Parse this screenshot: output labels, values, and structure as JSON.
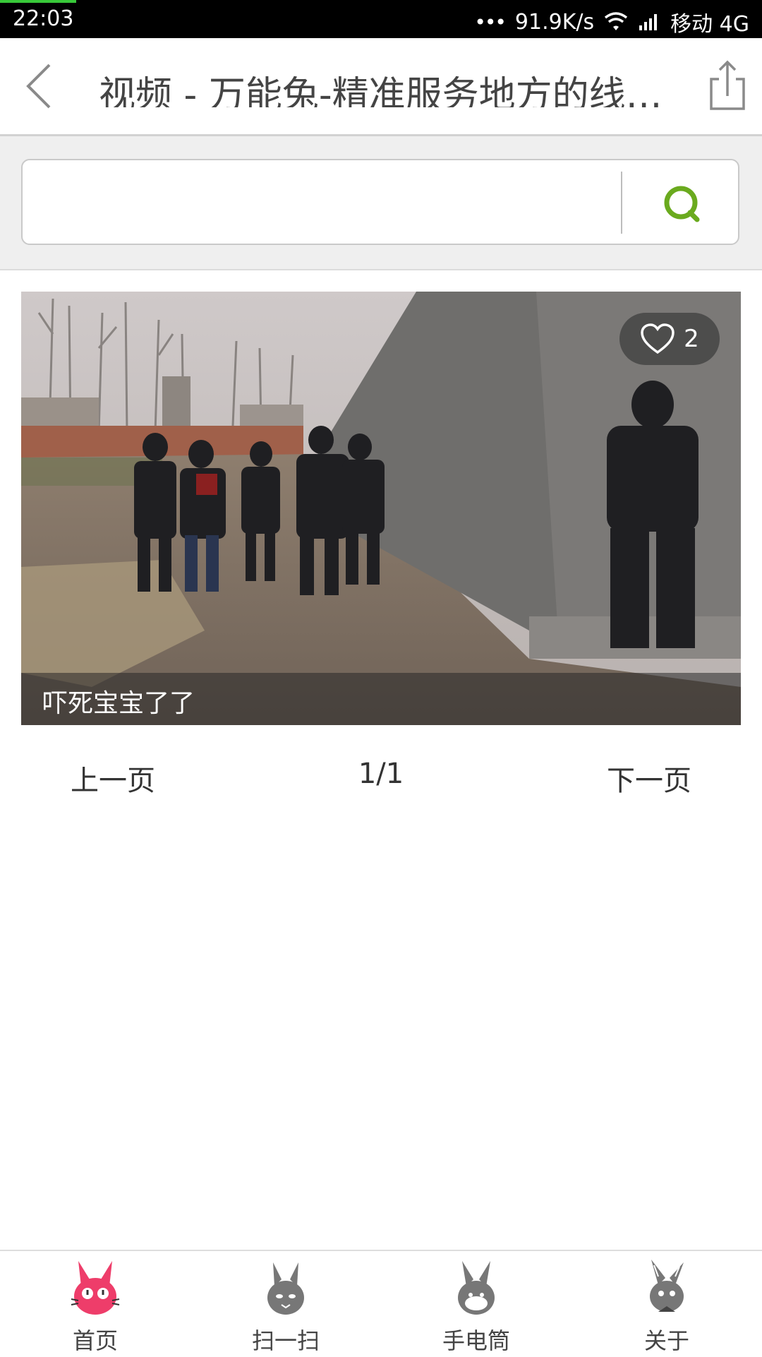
{
  "status_bar": {
    "time": "22:03",
    "dots": "•••",
    "speed": "91.9K/s",
    "carrier": "移动 4G",
    "accent_color": "#39c93a"
  },
  "header": {
    "title": "视频 - 万能兔-精准服务地方的线…",
    "back_icon": "chevron-left-icon",
    "share_icon": "share-icon"
  },
  "search": {
    "value": "",
    "placeholder": "",
    "button_icon": "search-icon",
    "button_color": "#6aaa1e"
  },
  "videos": [
    {
      "caption": "吓死宝宝了了",
      "likes": "2",
      "like_icon": "heart-icon"
    }
  ],
  "pagination": {
    "prev_label": "上一页",
    "page_indicator": "1/1",
    "next_label": "下一页"
  },
  "bottom_nav": {
    "items": [
      {
        "label": "首页",
        "icon": "rabbit-home-icon",
        "active": true,
        "color": "#ee3d6a"
      },
      {
        "label": "扫一扫",
        "icon": "rabbit-scan-icon",
        "active": false,
        "color": "#777777"
      },
      {
        "label": "手电筒",
        "icon": "rabbit-flashlight-icon",
        "active": false,
        "color": "#777777"
      },
      {
        "label": "关于",
        "icon": "rabbit-about-icon",
        "active": false,
        "color": "#777777"
      }
    ]
  }
}
